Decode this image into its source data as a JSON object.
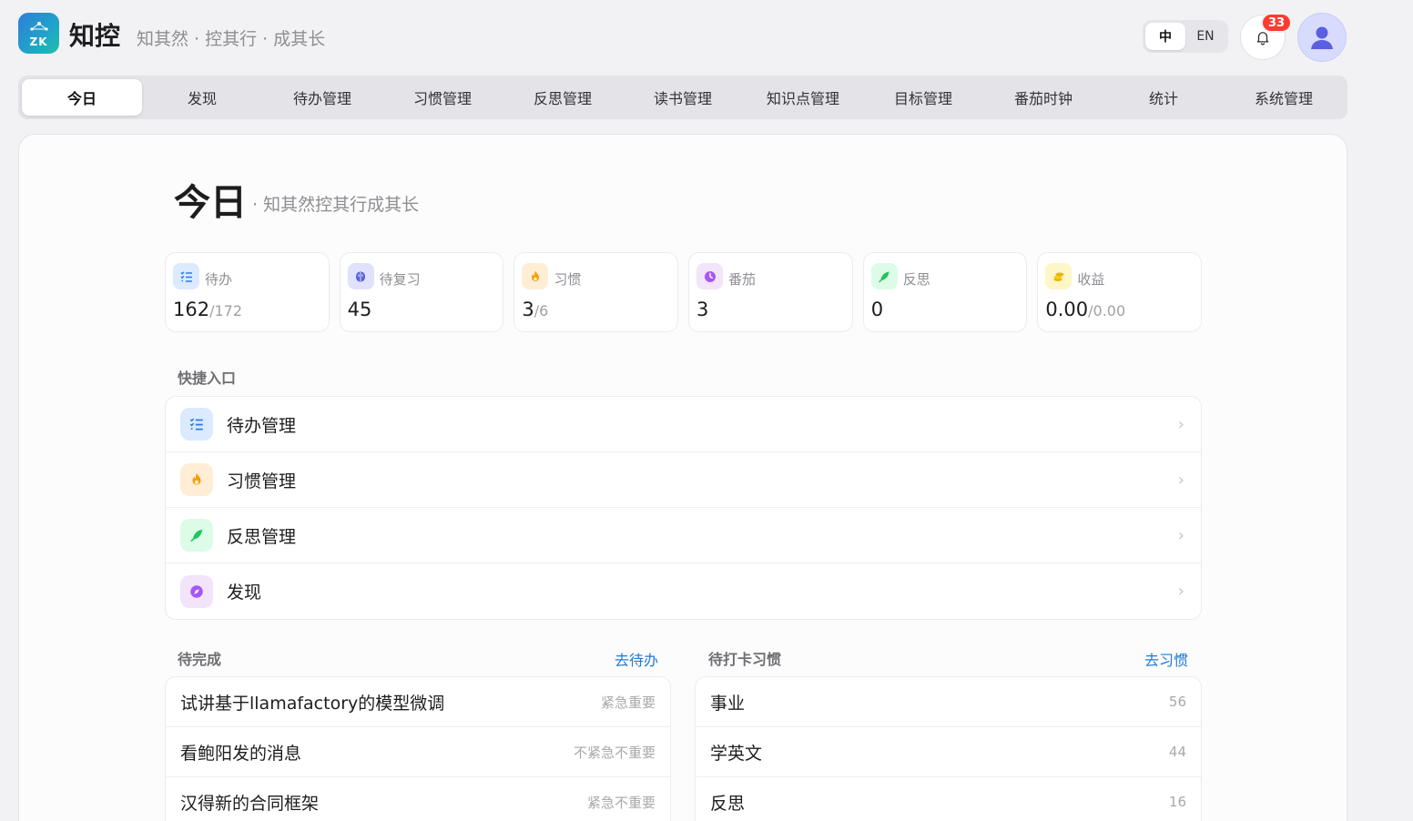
{
  "app": {
    "logo_text": "ZK",
    "name": "知控",
    "tagline": "知其然 · 控其行 · 成其长"
  },
  "lang_switch": {
    "zh": "中",
    "en": "EN",
    "active": "zh"
  },
  "notifications": {
    "count": "33"
  },
  "nav": {
    "items": [
      "今日",
      "发现",
      "待办管理",
      "习惯管理",
      "反思管理",
      "读书管理",
      "知识点管理",
      "目标管理",
      "番茄时钟",
      "统计",
      "系统管理"
    ],
    "active_index": 0
  },
  "page": {
    "title": "今日",
    "subtitle": "· 知其然控其行成其长"
  },
  "stats": [
    {
      "label": "待办",
      "value": "162",
      "total": "/172",
      "icon": "checklist-icon",
      "bg": "#dbeafe",
      "color": "#2f7ae5"
    },
    {
      "label": "待复习",
      "value": "45",
      "total": "",
      "icon": "brain-icon",
      "bg": "#e0e1fb",
      "color": "#5c5fd6"
    },
    {
      "label": "习惯",
      "value": "3",
      "total": "/6",
      "icon": "flame-icon",
      "bg": "#ffedd5",
      "color": "#f59e0b"
    },
    {
      "label": "番茄",
      "value": "3",
      "total": "",
      "icon": "clock-icon",
      "bg": "#f1e4fb",
      "color": "#a855f7"
    },
    {
      "label": "反思",
      "value": "0",
      "total": "",
      "icon": "quill-icon",
      "bg": "#dcfce7",
      "color": "#22c55e"
    },
    {
      "label": "收益",
      "value": "0.00",
      "total": "/0.00",
      "icon": "coins-icon",
      "bg": "#fef6c7",
      "color": "#eab308"
    }
  ],
  "quick_access": {
    "label": "快捷入口",
    "items": [
      {
        "label": "待办管理",
        "icon": "checklist-icon",
        "bg": "#dbeafe",
        "color": "#2f7ae5"
      },
      {
        "label": "习惯管理",
        "icon": "flame-icon",
        "bg": "#ffedd5",
        "color": "#f59e0b"
      },
      {
        "label": "反思管理",
        "icon": "quill-icon",
        "bg": "#dcfce7",
        "color": "#22c55e"
      },
      {
        "label": "发现",
        "icon": "compass-icon",
        "bg": "#f1e4fb",
        "color": "#a855f7"
      }
    ]
  },
  "pending_todos": {
    "label": "待完成",
    "link": "去待办",
    "items": [
      {
        "title": "试讲基于llamafactory的模型微调",
        "tag": "紧急重要"
      },
      {
        "title": "看鲍阳发的消息",
        "tag": "不紧急不重要"
      },
      {
        "title": "汉得新的合同框架",
        "tag": "紧急不重要"
      }
    ]
  },
  "pending_habits": {
    "label": "待打卡习惯",
    "link": "去习惯",
    "items": [
      {
        "title": "事业",
        "count": "56"
      },
      {
        "title": "学英文",
        "count": "44"
      },
      {
        "title": "反思",
        "count": "16"
      }
    ]
  }
}
